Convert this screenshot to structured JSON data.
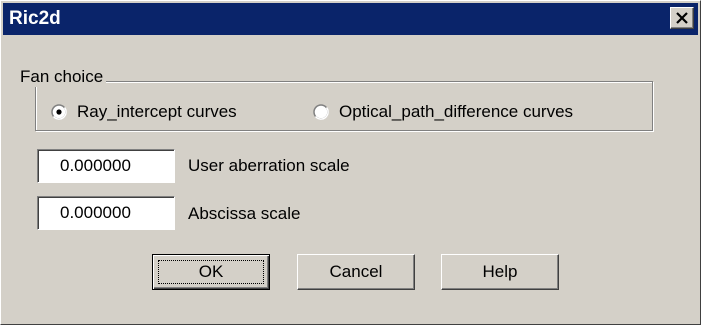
{
  "window": {
    "title": "Ric2d",
    "close_icon": "close-x-icon"
  },
  "fan_choice": {
    "legend": "Fan choice",
    "options": [
      {
        "label": "Ray_intercept curves",
        "selected": true
      },
      {
        "label": "Optical_path_difference curves",
        "selected": false
      }
    ]
  },
  "fields": [
    {
      "value": "0.000000",
      "label": "User aberration scale"
    },
    {
      "value": "0.000000",
      "label": "Abscissa scale"
    }
  ],
  "buttons": {
    "ok": "OK",
    "cancel": "Cancel",
    "help": "Help"
  },
  "colors": {
    "titlebar": "#0a246a",
    "face": "#d4d0c8"
  }
}
